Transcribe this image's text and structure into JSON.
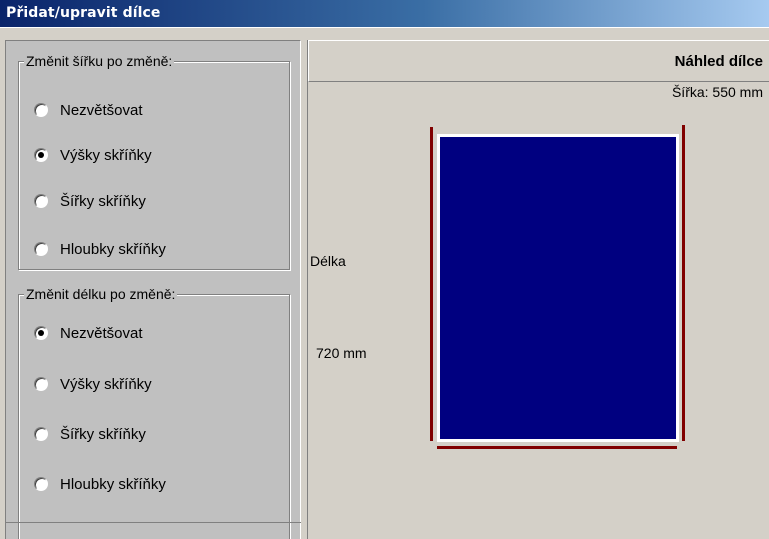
{
  "window": {
    "title": "Přidat/upravit dílce"
  },
  "width_group": {
    "legend": "Změnit šířku po změně:",
    "options": [
      {
        "label": "Nezvětšovat",
        "checked": false
      },
      {
        "label": "Výšky skříňky",
        "checked": true
      },
      {
        "label": "Šířky skříňky",
        "checked": false
      },
      {
        "label": "Hloubky skříňky",
        "checked": false
      }
    ]
  },
  "length_group": {
    "legend": "Změnit délku po změně:",
    "options": [
      {
        "label": "Nezvětšovat",
        "checked": true
      },
      {
        "label": "Výšky skříňky",
        "checked": false
      },
      {
        "label": "Šířky skříňky",
        "checked": false
      },
      {
        "label": "Hloubky skříňky",
        "checked": false
      }
    ]
  },
  "preview": {
    "title": "Náhled dílce",
    "width_text": "Šířka: 550 mm",
    "length_label": "Délka",
    "length_value": "720 mm",
    "part_color": "#000080",
    "dimension_line_color": "#800000"
  }
}
